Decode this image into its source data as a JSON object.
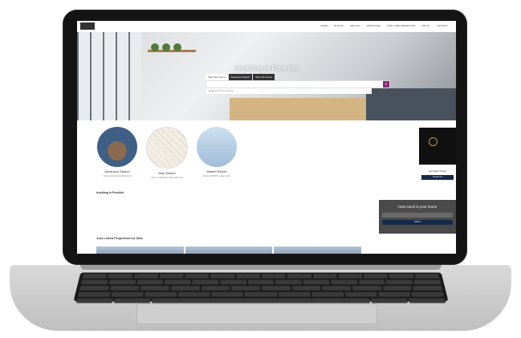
{
  "nav": {
    "items": [
      "HOME",
      "BUYING",
      "SELLING",
      "MORTGAGE",
      "FIND A NEIGHBORHOOD",
      "ABOUT",
      "CONTACT"
    ]
  },
  "hero": {
    "title": "Anything is Possible",
    "tabs": [
      "Find Your Home",
      "Advanced Search",
      "Sell Your Home"
    ],
    "search_placeholder": "Search For Your Home"
  },
  "features": [
    {
      "title": "Advanced Search",
      "subtitle": "Find your perfect neighborhood"
    },
    {
      "title": "Map Search",
      "subtitle": "Use our interactive map search tool"
    },
    {
      "title": "Market Report",
      "subtitle": "Get an INSTANT market report"
    }
  ],
  "about": {
    "heading": "Anything is Possible"
  },
  "listings": {
    "title": "Just Listed Properties for Sale"
  },
  "agent": {
    "name": "Gonzalez Group",
    "contact_label": "Contact Us"
  },
  "home_value": {
    "title": "How much is your home",
    "submit_label": "Submit"
  }
}
